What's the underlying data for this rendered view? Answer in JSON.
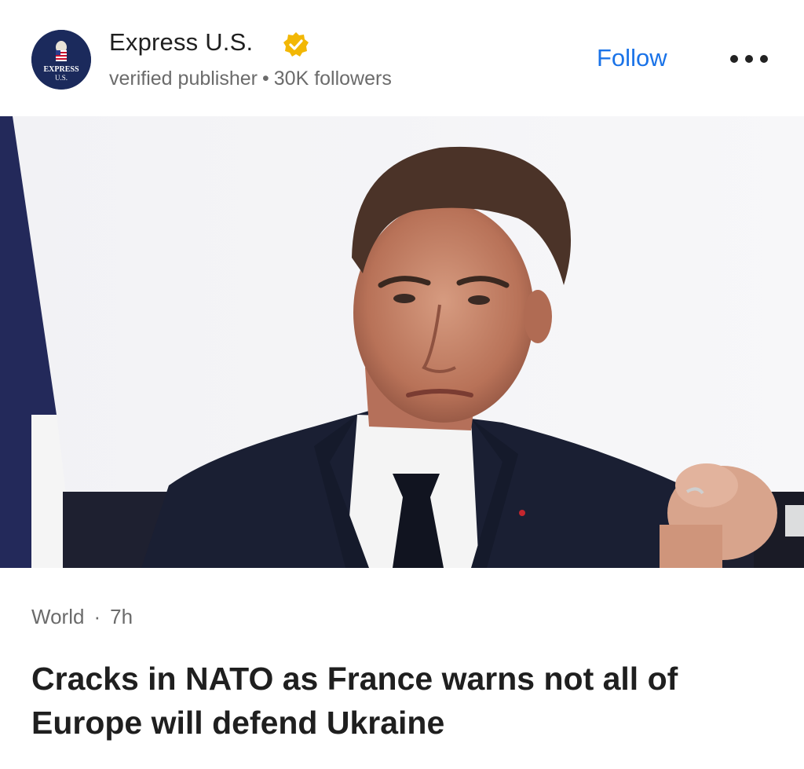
{
  "publisher": {
    "name": "Express U.S.",
    "logo_text_line1": "EXPRESS",
    "logo_text_line2": "U.S.",
    "subtitle": "verified publisher",
    "separator": "•",
    "followers": "30K followers",
    "verified_icon": "verified-check-icon"
  },
  "actions": {
    "follow_label": "Follow",
    "more_icon": "more-horizontal-icon"
  },
  "hero_image": {
    "description_icon": "news-photo"
  },
  "article": {
    "category": "World",
    "separator": "·",
    "age": "7h",
    "headline": "Cracks in NATO as France warns not all of Europe will defend Ukraine"
  },
  "colors": {
    "accent": "#1a73e8",
    "logo_bg": "#1b2a5c",
    "badge": "#f2b705"
  }
}
